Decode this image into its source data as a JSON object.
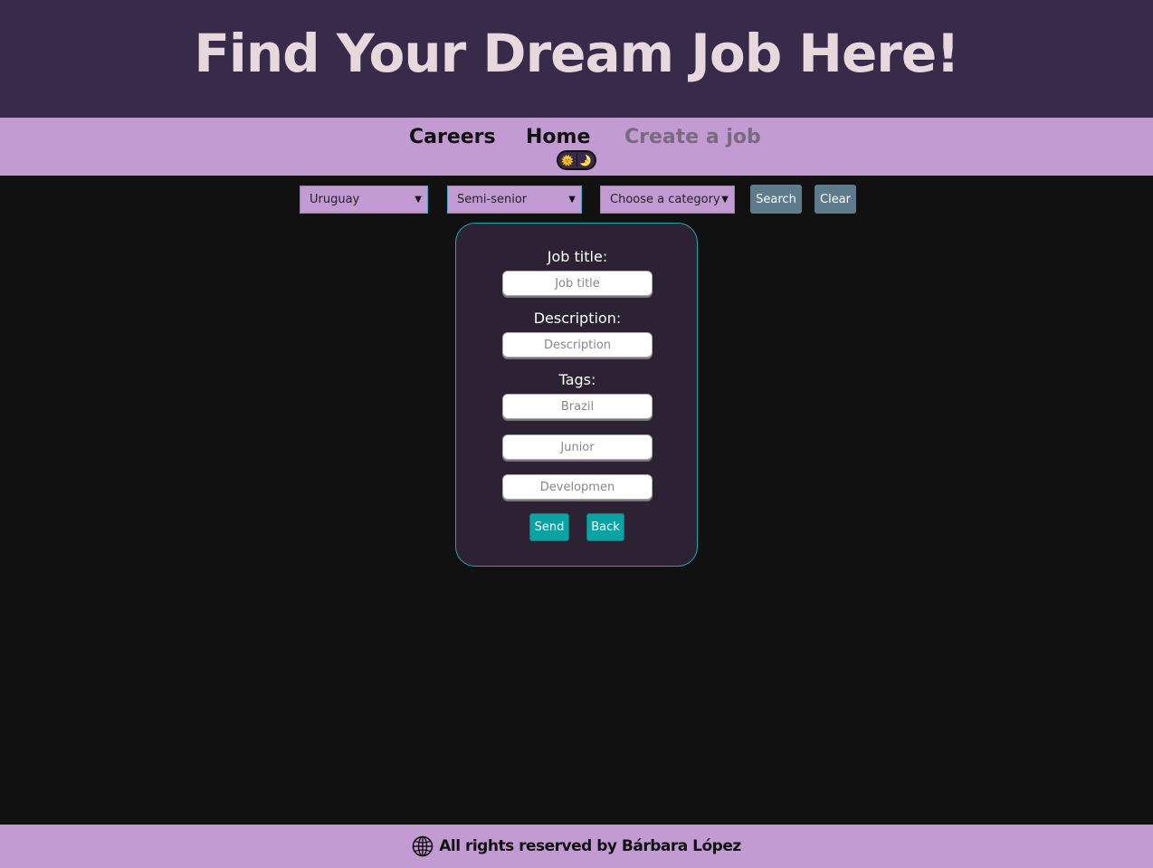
{
  "header": {
    "title": "Find Your Dream Job Here!"
  },
  "nav": {
    "careers": "Careers",
    "home": "Home",
    "create_job": "Create a job",
    "theme_sun": "🌞",
    "theme_moon": "🌛"
  },
  "filters": {
    "country": "Uruguay",
    "seniority": "Semi-senior",
    "category": "Choose a category",
    "search_label": "Search",
    "clear_label": "Clear"
  },
  "form": {
    "job_title_label": "Job title:",
    "job_title_placeholder": "Job title",
    "description_label": "Description:",
    "description_placeholder": "Description",
    "tags_label": "Tags:",
    "tag1_placeholder": "Brazil",
    "tag2_placeholder": "Junior",
    "tag3_placeholder": "Developmen",
    "send_label": "Send",
    "back_label": "Back"
  },
  "footer": {
    "text": "All rights reserved by Bárbara López"
  }
}
